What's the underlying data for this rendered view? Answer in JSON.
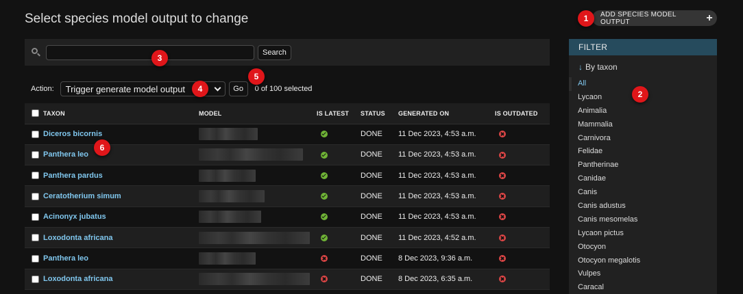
{
  "page": {
    "title": "Select species model output to change",
    "add_button_label": "ADD SPECIES MODEL OUTPUT"
  },
  "search": {
    "value": "",
    "placeholder": "",
    "button_label": "Search"
  },
  "actions": {
    "label": "Action:",
    "selected_action": "Trigger generate model output",
    "go_label": "Go",
    "selected_count": "0 of 100 selected"
  },
  "table": {
    "columns": [
      "TAXON",
      "MODEL",
      "IS LATEST",
      "STATUS",
      "GENERATED ON",
      "IS OUTDATED"
    ],
    "rows": [
      {
        "taxon": "Diceros bicornis",
        "model_width": 0.52,
        "is_latest": true,
        "status": "DONE",
        "generated_on": "11 Dec 2023, 4:53 a.m.",
        "is_outdated": false
      },
      {
        "taxon": "Panthera leo",
        "model_width": 0.92,
        "is_latest": true,
        "status": "DONE",
        "generated_on": "11 Dec 2023, 4:53 a.m.",
        "is_outdated": false
      },
      {
        "taxon": "Panthera pardus",
        "model_width": 0.5,
        "is_latest": true,
        "status": "DONE",
        "generated_on": "11 Dec 2023, 4:53 a.m.",
        "is_outdated": false
      },
      {
        "taxon": "Ceratotherium simum",
        "model_width": 0.58,
        "is_latest": true,
        "status": "DONE",
        "generated_on": "11 Dec 2023, 4:53 a.m.",
        "is_outdated": false
      },
      {
        "taxon": "Acinonyx jubatus",
        "model_width": 0.55,
        "is_latest": true,
        "status": "DONE",
        "generated_on": "11 Dec 2023, 4:53 a.m.",
        "is_outdated": false
      },
      {
        "taxon": "Loxodonta africana",
        "model_width": 0.98,
        "is_latest": true,
        "status": "DONE",
        "generated_on": "11 Dec 2023, 4:52 a.m.",
        "is_outdated": false
      },
      {
        "taxon": "Panthera leo",
        "model_width": 0.5,
        "is_latest": false,
        "status": "DONE",
        "generated_on": "8 Dec 2023, 9:36 a.m.",
        "is_outdated": false
      },
      {
        "taxon": "Loxodonta africana",
        "model_width": 0.98,
        "is_latest": false,
        "status": "DONE",
        "generated_on": "8 Dec 2023, 6:35 a.m.",
        "is_outdated": false
      }
    ]
  },
  "filter": {
    "header": "FILTER",
    "group_label": "By taxon",
    "items": [
      "All",
      "Lycaon",
      "Animalia",
      "Mammalia",
      "Carnivora",
      "Felidae",
      "Pantherinae",
      "Canidae",
      "Canis",
      "Canis adustus",
      "Canis mesomelas",
      "Lycaon pictus",
      "Otocyon",
      "Otocyon megalotis",
      "Vulpes",
      "Caracal"
    ],
    "selected_index": 0
  },
  "markers": [
    "1",
    "2",
    "3",
    "4",
    "5",
    "6"
  ],
  "colors": {
    "background": "#121212",
    "link": "#80c7ee",
    "filter_header": "#264b5d",
    "yes": "#6fb336",
    "no": "#dd4646",
    "marker": "#e0161a"
  }
}
